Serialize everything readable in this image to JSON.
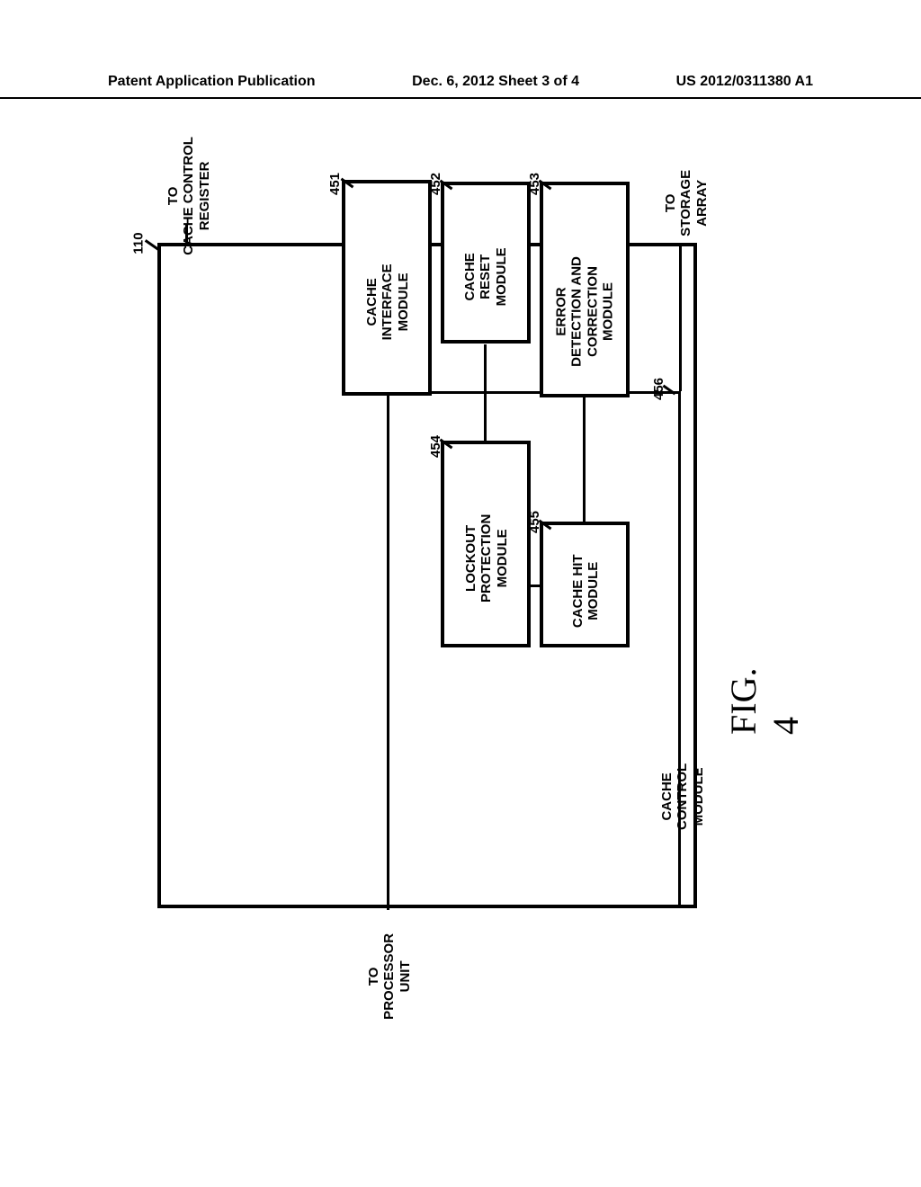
{
  "header": {
    "left": "Patent Application Publication",
    "center": "Dec. 6, 2012  Sheet 3 of 4",
    "right": "US 2012/0311380 A1"
  },
  "external": {
    "processor": "TO\nPROCESSOR\nUNIT",
    "ccr": "TO\nCACHE CONTROL\nREGISTER",
    "storage": "TO\nSTORAGE\nARRAY"
  },
  "outer": {
    "ref": "110",
    "title": "CACHE CONTROL\nMODULE"
  },
  "modules": {
    "m451": {
      "ref": "451",
      "label": "CACHE\nINTERFACE\nMODULE"
    },
    "m452": {
      "ref": "452",
      "label": "CACHE\nRESET\nMODULE"
    },
    "m453": {
      "ref": "453",
      "label": "ERROR\nDETECTION AND\nCORRECTION\nMODULE"
    },
    "m454": {
      "ref": "454",
      "label": "LOCKOUT\nPROTECTION\nMODULE"
    },
    "m455": {
      "ref": "455",
      "label": "CACHE HIT\nMODULE"
    },
    "bus": {
      "ref": "456"
    }
  },
  "figure": {
    "label": "FIG. 4"
  }
}
